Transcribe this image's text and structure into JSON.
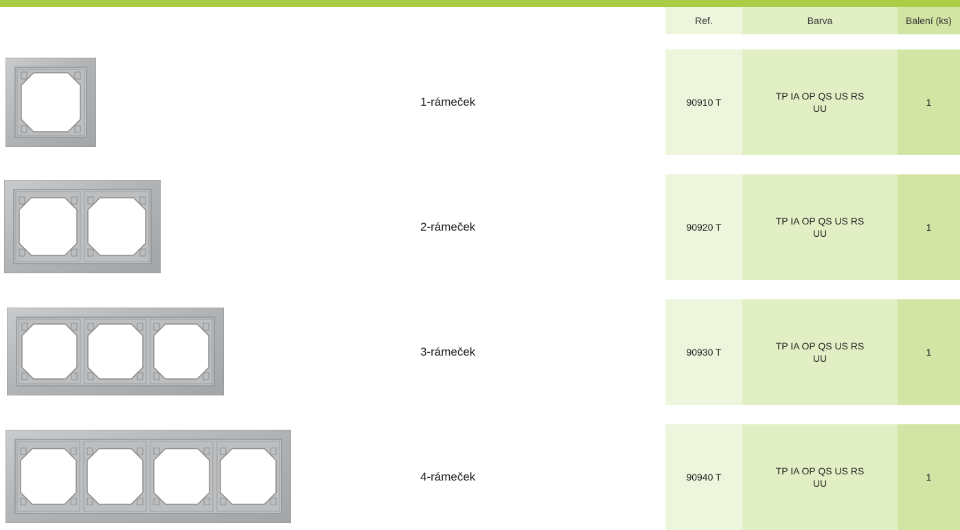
{
  "header": {
    "columns": [
      "Ref.",
      "Barva",
      "Balení (ks)"
    ]
  },
  "rows": [
    {
      "name": "1-rámeček",
      "ref": "90910 T",
      "barva": "TP IA OP QS US RS UU",
      "baleni": "1",
      "gangs": 1
    },
    {
      "name": "2-rámeček",
      "ref": "90920 T",
      "barva": "TP IA OP QS US RS UU",
      "baleni": "1",
      "gangs": 2
    },
    {
      "name": "3-rámeček",
      "ref": "90930 T",
      "barva": "TP IA OP QS US RS UU",
      "baleni": "1",
      "gangs": 3
    },
    {
      "name": "4-rámeček",
      "ref": "90940 T",
      "barva": "TP IA OP QS US RS UU",
      "baleni": "1",
      "gangs": 4
    }
  ],
  "colors": {
    "accent": "#a9cd45",
    "ref_col": "#edf5dc",
    "barva_col": "#e2efc4",
    "baleni_col": "#d3e5a4",
    "frame": "#b4b6b8"
  }
}
